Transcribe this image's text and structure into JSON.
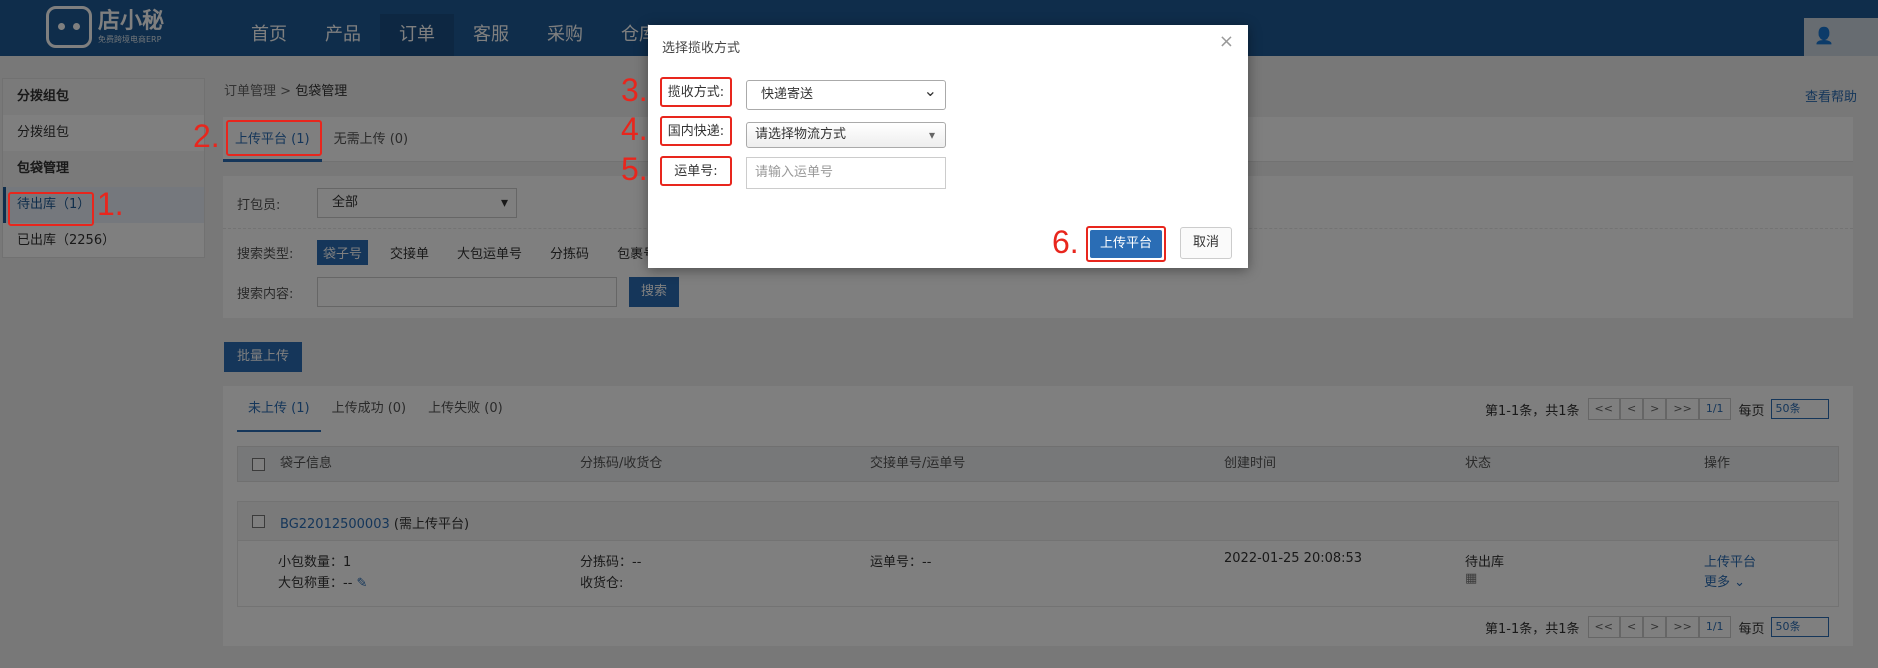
{
  "header": {
    "logo_name": "店小秘",
    "logo_sub": "免费跨境电商ERP",
    "nav": [
      "首页",
      "产品",
      "订单",
      "客服",
      "采购",
      "仓库"
    ],
    "active_nav": "订单"
  },
  "sidebar": {
    "group1": "分拨组包",
    "item1": "分拨组包",
    "group2": "包袋管理",
    "item2": "待出库（1）",
    "item3": "已出库（2256）"
  },
  "breadcrumb": {
    "parent": "订单管理",
    "sep": " > ",
    "current": "包袋管理"
  },
  "help_link": "查看帮助",
  "top_tabs": [
    "上传平台 (1)",
    "无需上传 (0)"
  ],
  "filter": {
    "packer_label": "打包员:",
    "packer_value": "全部",
    "search_type_label": "搜索类型:",
    "search_types": [
      "袋子号",
      "交接单",
      "大包运单号",
      "分拣码",
      "包裹号"
    ],
    "search_content_label": "搜索内容:",
    "search_button": "搜索"
  },
  "batch_upload": "批量上传",
  "sub_tabs": [
    "未上传 (1)",
    "上传成功 (0)",
    "上传失败 (0)"
  ],
  "pager": {
    "summary": "第1-1条，共1条",
    "first": "<<",
    "prev": "<",
    "next": ">",
    "last": ">>",
    "current": "1/1",
    "per_page_label": "每页",
    "per_page_value": "50条"
  },
  "table": {
    "headers": [
      "袋子信息",
      "分拣码/收货仓",
      "交接单号/运单号",
      "创建时间",
      "状态",
      "操作"
    ],
    "row": {
      "bag_no": "BG22012500003",
      "bag_note": "(需上传平台)",
      "small_count_label": "小包数量：",
      "small_count": "1",
      "weight_label": "大包称重：",
      "weight": "--",
      "sort_code_label": "分拣码：",
      "sort_code": "--",
      "warehouse_label": "收货仓:",
      "waybill_label": "运单号：",
      "waybill": "--",
      "created": "2022-01-25 20:08:53",
      "status": "待出库",
      "action_upload": "上传平台",
      "action_more": "更多"
    }
  },
  "modal": {
    "title": "选择揽收方式",
    "close": "×",
    "pickup_label": "揽收方式:",
    "pickup_value": "快递寄送",
    "express_label": "国内快递:",
    "express_value": "请选择物流方式",
    "waybill_label": "运单号:",
    "waybill_placeholder": "请输入运单号",
    "upload_button": "上传平台",
    "cancel_button": "取消"
  },
  "annotations": [
    "1.",
    "2.",
    "3.",
    "4.",
    "5.",
    "6."
  ],
  "colors": {
    "header_bg": "#1e5b96",
    "accent": "#2a6db5",
    "annotation": "#e8261d"
  }
}
